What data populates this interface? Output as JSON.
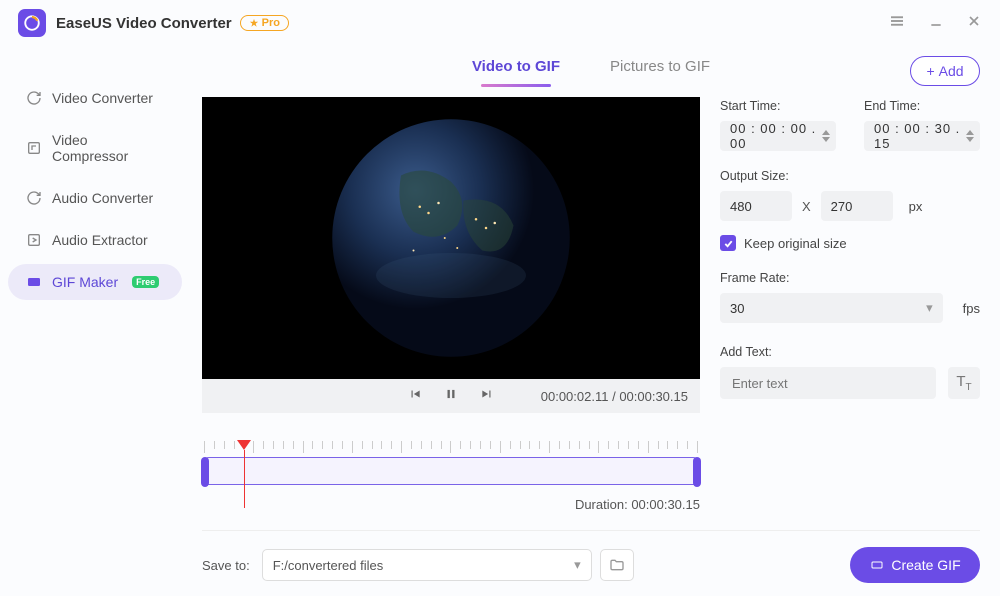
{
  "app": {
    "title": "EaseUS Video Converter",
    "pro_label": "Pro"
  },
  "sidebar": {
    "items": [
      {
        "label": "Video Converter"
      },
      {
        "label": "Video Compressor"
      },
      {
        "label": "Audio Converter"
      },
      {
        "label": "Audio Extractor"
      },
      {
        "label": "GIF Maker",
        "badge": "Free"
      }
    ]
  },
  "tabs": {
    "video": "Video to GIF",
    "pictures": "Pictures to GIF"
  },
  "add_button": "Add",
  "player": {
    "current": "00:00:02.11",
    "total": "00:00:30.15"
  },
  "timeline": {
    "duration_label": "Duration:",
    "duration": "00:00:30.15"
  },
  "settings": {
    "start_label": "Start Time:",
    "start_value": "00 : 00 : 00 . 00",
    "end_label": "End Time:",
    "end_value": "00 : 00 : 30 . 15",
    "size_label": "Output Size:",
    "width": "480",
    "height": "270",
    "size_unit": "px",
    "x": "X",
    "keep_original": "Keep original size",
    "framerate_label": "Frame Rate:",
    "framerate_value": "30",
    "framerate_unit": "fps",
    "addtext_label": "Add Text:",
    "addtext_placeholder": "Enter text"
  },
  "footer": {
    "save_label": "Save to:",
    "path": "F:/convertered files",
    "create_label": "Create GIF"
  }
}
